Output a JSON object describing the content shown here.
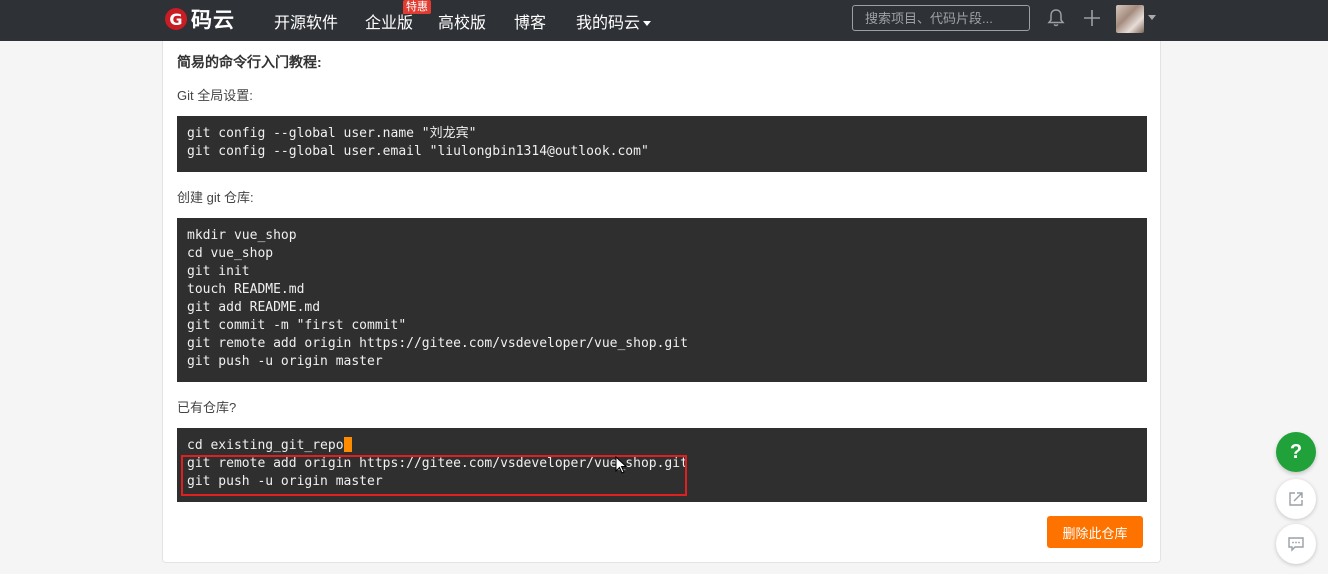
{
  "navbar": {
    "logo_mark": "G",
    "logo_text": "码云",
    "items": [
      {
        "label": "开源软件"
      },
      {
        "label": "企业版"
      },
      {
        "label": "高校版"
      },
      {
        "label": "博客"
      },
      {
        "label": "我的码云"
      }
    ],
    "hot_badge": "特惠",
    "search_placeholder": "搜索项目、代码片段...",
    "icons": [
      "bell-icon",
      "plus-icon",
      "avatar"
    ]
  },
  "content": {
    "title": "简易的命令行入门教程:",
    "sections": [
      {
        "label": "Git 全局设置:",
        "lines": [
          "git config --global user.name \"刘龙宾\"",
          "git config --global user.email \"liulongbin1314@outlook.com\""
        ]
      },
      {
        "label": "创建 git 仓库:",
        "lines": [
          "mkdir vue_shop",
          "cd vue_shop",
          "git init",
          "touch README.md",
          "git add README.md",
          "git commit -m \"first commit\"",
          "git remote add origin https://gitee.com/vsdeveloper/vue_shop.git",
          "git push -u origin master"
        ]
      },
      {
        "label": "已有仓库?",
        "lines": [
          "cd existing_git_repo",
          "git remote add origin https://gitee.com/vsdeveloper/vue_shop.git",
          "git push -u origin master"
        ]
      }
    ],
    "delete_button": "删除此仓库"
  },
  "floating": {
    "help_label": "?"
  },
  "colors": {
    "navbar_bg": "#2e3136",
    "code_bg": "#2f2f2f",
    "accent_orange": "#fe7300",
    "help_green": "#21a139",
    "highlight_red": "#e02020"
  }
}
